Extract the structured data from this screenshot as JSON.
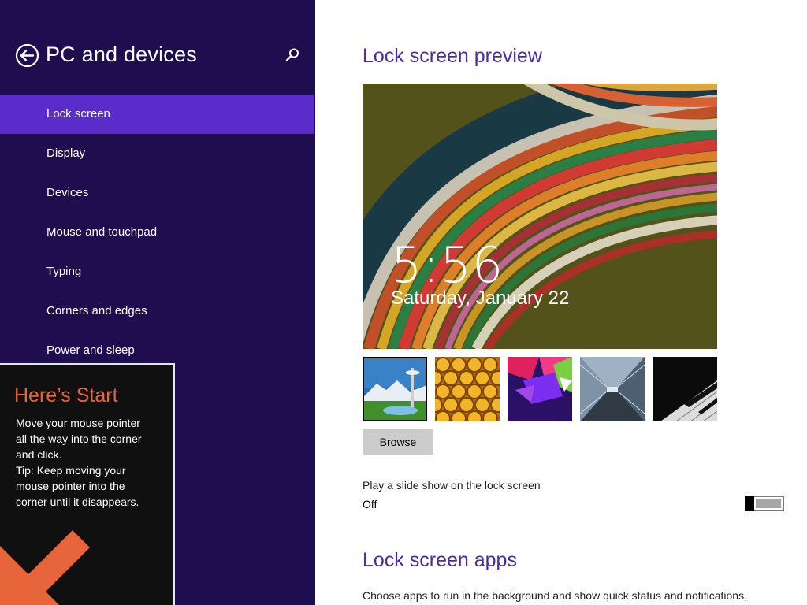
{
  "sidebar": {
    "title": "PC and devices",
    "back_icon": "back-arrow-icon",
    "search_icon": "search-icon",
    "items": [
      {
        "label": "Lock screen",
        "selected": true
      },
      {
        "label": "Display",
        "selected": false
      },
      {
        "label": "Devices",
        "selected": false
      },
      {
        "label": "Mouse and touchpad",
        "selected": false
      },
      {
        "label": "Typing",
        "selected": false
      },
      {
        "label": "Corners and edges",
        "selected": false
      },
      {
        "label": "Power and sleep",
        "selected": false
      }
    ]
  },
  "tip": {
    "title": "Here’s Start",
    "lines": [
      "Move your mouse pointer",
      "all the way into the corner",
      "and click.",
      "Tip: Keep moving your",
      "mouse pointer into the",
      "corner until it disappears."
    ],
    "arrow_icon": "down-left-arrow-icon"
  },
  "main": {
    "preview_title": "Lock screen preview",
    "preview": {
      "time": "5:56",
      "date": "Saturday, January 22"
    },
    "thumbnails": [
      {
        "name": "space-needle-thumbnail",
        "selected": true
      },
      {
        "name": "honeycomb-thumbnail",
        "selected": false
      },
      {
        "name": "color-shapes-thumbnail",
        "selected": false
      },
      {
        "name": "tunnel-thumbnail",
        "selected": false
      },
      {
        "name": "piano-keys-thumbnail",
        "selected": false
      }
    ],
    "browse_label": "Browse",
    "slideshow": {
      "label": "Play a slide show on the lock screen",
      "state": "Off",
      "on": false
    },
    "apps_title": "Lock screen apps",
    "apps_description": "Choose apps to run in the background and show quick status and notifications,"
  },
  "colors": {
    "sidebar_bg": "#1f0e4f",
    "selected_item_bg": "#5a2cc9",
    "heading": "#4a2aa6",
    "tip_title": "#e8643a",
    "tip_arrow": "#e8643a"
  }
}
